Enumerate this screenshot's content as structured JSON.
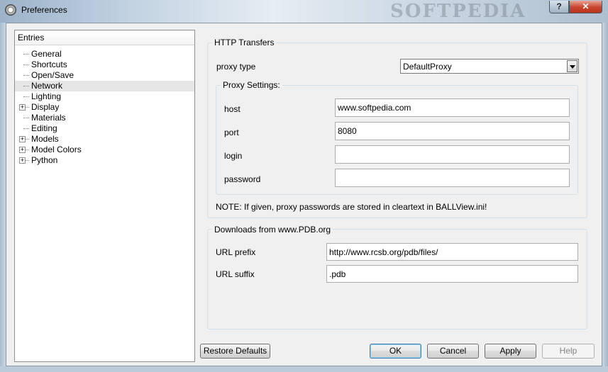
{
  "window": {
    "title": "Preferences",
    "help_glyph": "?",
    "close_glyph": "✕",
    "watermark": "SOFTPEDIA"
  },
  "tree": {
    "header": "Entries",
    "items": [
      {
        "label": "General",
        "expandable": false
      },
      {
        "label": "Shortcuts",
        "expandable": false
      },
      {
        "label": "Open/Save",
        "expandable": false
      },
      {
        "label": "Network",
        "expandable": false,
        "selected": true
      },
      {
        "label": "Lighting",
        "expandable": false
      },
      {
        "label": "Display",
        "expandable": true
      },
      {
        "label": "Materials",
        "expandable": false
      },
      {
        "label": "Editing",
        "expandable": false
      },
      {
        "label": "Models",
        "expandable": true
      },
      {
        "label": "Model Colors",
        "expandable": true
      },
      {
        "label": "Python",
        "expandable": true
      }
    ]
  },
  "http": {
    "title": "HTTP Transfers",
    "proxy_type_label": "proxy type",
    "proxy_type_value": "DefaultProxy",
    "proxy_settings_title": "Proxy Settings:",
    "host_label": "host",
    "host_value": "www.softpedia.com",
    "port_label": "port",
    "port_value": "8080",
    "login_label": "login",
    "login_value": "",
    "password_label": "password",
    "password_value": "",
    "note": "NOTE: If given, proxy passwords are stored in cleartext in BALLView.ini!"
  },
  "downloads": {
    "title": "Downloads from www.PDB.org",
    "url_prefix_label": "URL prefix",
    "url_prefix_value": "http://www.rcsb.org/pdb/files/",
    "url_suffix_label": "URL suffix",
    "url_suffix_value": ".pdb"
  },
  "buttons": {
    "restore_defaults": "Restore Defaults",
    "ok": "OK",
    "cancel": "Cancel",
    "apply": "Apply",
    "help": "Help"
  }
}
